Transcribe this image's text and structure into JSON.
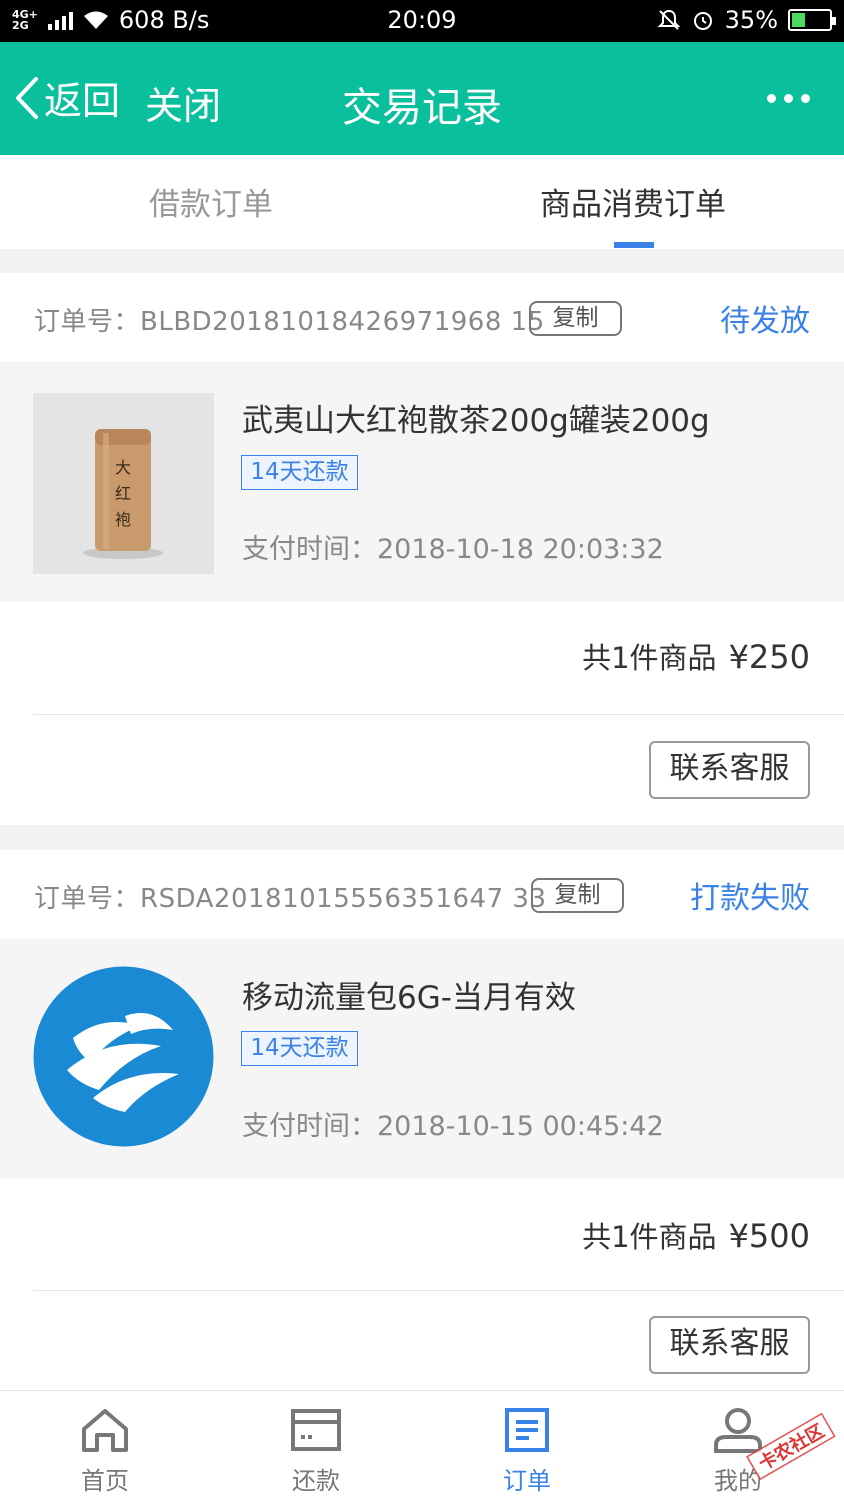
{
  "status_bar": {
    "network": "4G+\n2G",
    "speed": "608 B/s",
    "time": "20:09",
    "battery": "35%",
    "battery_level": 0.35
  },
  "header": {
    "back_label": "返回",
    "close_label": "关闭",
    "title": "交易记录",
    "more_icon": "more-icon"
  },
  "tabs": [
    {
      "label": "借款订单",
      "active": false
    },
    {
      "label": "商品消费订单",
      "active": true
    }
  ],
  "orders": [
    {
      "order_label": "订单号：BLBD20181018426971968 15",
      "copy_label": "复制",
      "status": "待发放",
      "product_name": "武夷山大红袍散茶200g罐装200g",
      "tag": "14天还款",
      "pay_time": "支付时间：2018-10-18 20:03:32",
      "count_text": "共1件商品",
      "price": "¥250",
      "service_label": "联系客服",
      "thumb_text": "大红袍"
    },
    {
      "order_label": "订单号：RSDA20181015556351647 33",
      "copy_label": "复制",
      "status": "打款失败",
      "product_name": "移动流量包6G-当月有效",
      "tag": "14天还款",
      "pay_time": "支付时间：2018-10-15 00:45:42",
      "count_text": "共1件商品",
      "price": "¥500",
      "service_label": "联系客服"
    }
  ],
  "bottom_nav": [
    {
      "label": "首页",
      "icon": "home-icon",
      "active": false
    },
    {
      "label": "还款",
      "icon": "card-icon",
      "active": false
    },
    {
      "label": "订单",
      "icon": "order-icon",
      "active": true
    },
    {
      "label": "我的",
      "icon": "user-icon",
      "active": false
    }
  ],
  "watermark": "卡农社区",
  "colors": {
    "header": "#0abf9b",
    "accent": "#3b82e8"
  }
}
